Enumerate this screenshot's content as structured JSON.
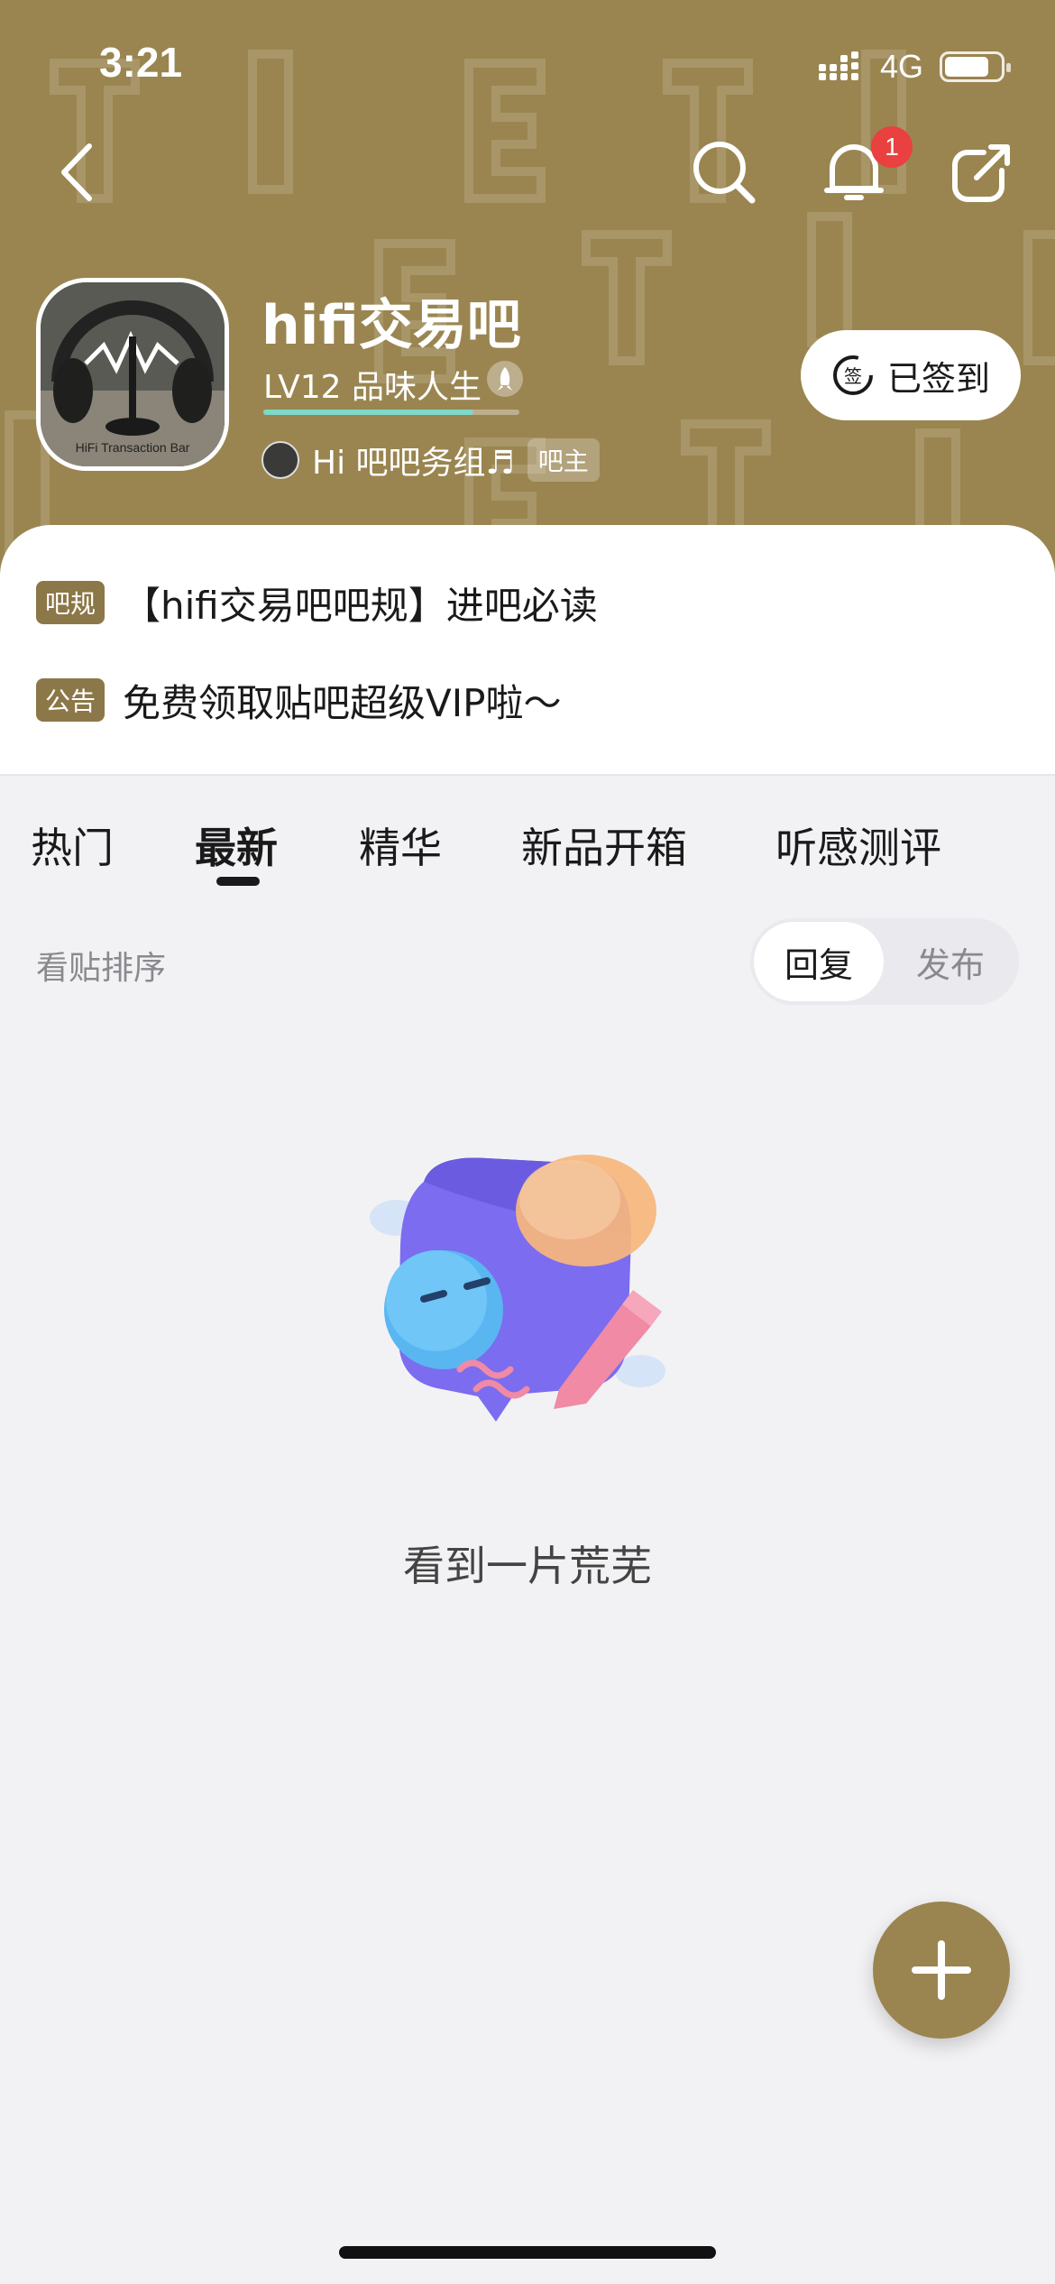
{
  "status_bar": {
    "time": "3:21",
    "network": "4G",
    "battery_level": 0.8
  },
  "header": {
    "notification_count": "1",
    "forum_name": "hifi交易吧",
    "level_text": "LV12 品味人生",
    "level_progress": 0.82,
    "admin_name": "Hi 吧吧务组♬",
    "admin_tag": "吧主",
    "signed_label": "已签到",
    "avatar_caption": "HiFi  Transaction  Bar"
  },
  "notices": [
    {
      "tag": "吧规",
      "text": "【hifi交易吧吧规】进吧必读"
    },
    {
      "tag": "公告",
      "text": "免费领取贴吧超级VIP啦～"
    }
  ],
  "tabs": [
    {
      "label": "热门"
    },
    {
      "label": "最新"
    },
    {
      "label": "精华"
    },
    {
      "label": "新品开箱"
    },
    {
      "label": "听感测评"
    }
  ],
  "sort": {
    "label": "看贴排序",
    "options": [
      "回复",
      "发布"
    ],
    "selected": "回复"
  },
  "empty": {
    "text": "看到一片荒芜"
  },
  "colors": {
    "brand": "#9a8550",
    "tag_bg": "#8c7748",
    "badge": "#e94040"
  },
  "icons": [
    "back-icon",
    "search-icon",
    "bell-icon",
    "share-icon",
    "sign-icon",
    "plus-icon",
    "rocket-icon"
  ]
}
